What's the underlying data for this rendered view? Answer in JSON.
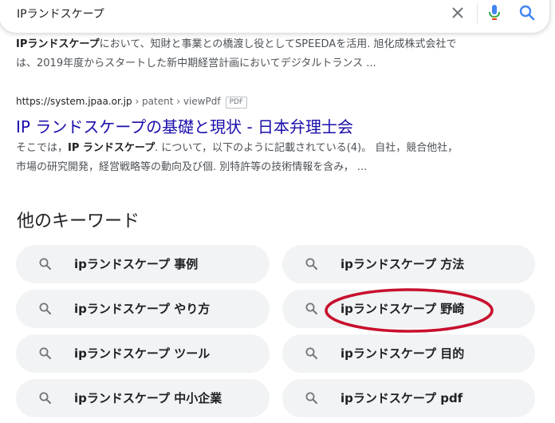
{
  "search": {
    "query": "IPランドスケープ"
  },
  "icons": {
    "clear": "close-icon",
    "voice": "microphone-icon",
    "search": "search-icon"
  },
  "colors": {
    "link": "#1a0dab",
    "chip_background": "#f1f3f4",
    "annotation": "#c8102e",
    "google_blue": "#4285f4"
  },
  "results": [
    {
      "snippet_bold": "IPランドスケープ",
      "snippet_line1_rest": "において、知財と事業との橋渡し役としてSPEEDAを活用. 旭化成株式会社で",
      "snippet_line2": "は、2019年度からスタートした新中期経営計画においてデジタルトランス ..."
    },
    {
      "cite_domain": "https://system.jpaa.or.jp",
      "cite_path": " › patent › viewPdf",
      "file_type": "PDF",
      "title": "IP ランドスケープの基礎と現状 - 日本弁理士会",
      "snippet_line1_pre": "そこでは，",
      "snippet_bold": "IP ランドスケープ",
      "snippet_line1_rest": ". について，以下のように記載されている(4)。 自社，競合他社，",
      "snippet_line2": "市場の研究開発，経営戦略等の動向及び個. 別特許等の技術情報を含み， ..."
    }
  ],
  "related": {
    "heading": "他のキーワード",
    "items": [
      "ipランドスケープ 事例",
      "ipランドスケープ 方法",
      "ipランドスケープ やり方",
      "ipランドスケープ 野崎",
      "ipランドスケープ ツール",
      "ipランドスケープ 目的",
      "ipランドスケープ 中小企業",
      "ipランドスケープ pdf"
    ],
    "highlighted": "ipランドスケープ 野崎"
  }
}
